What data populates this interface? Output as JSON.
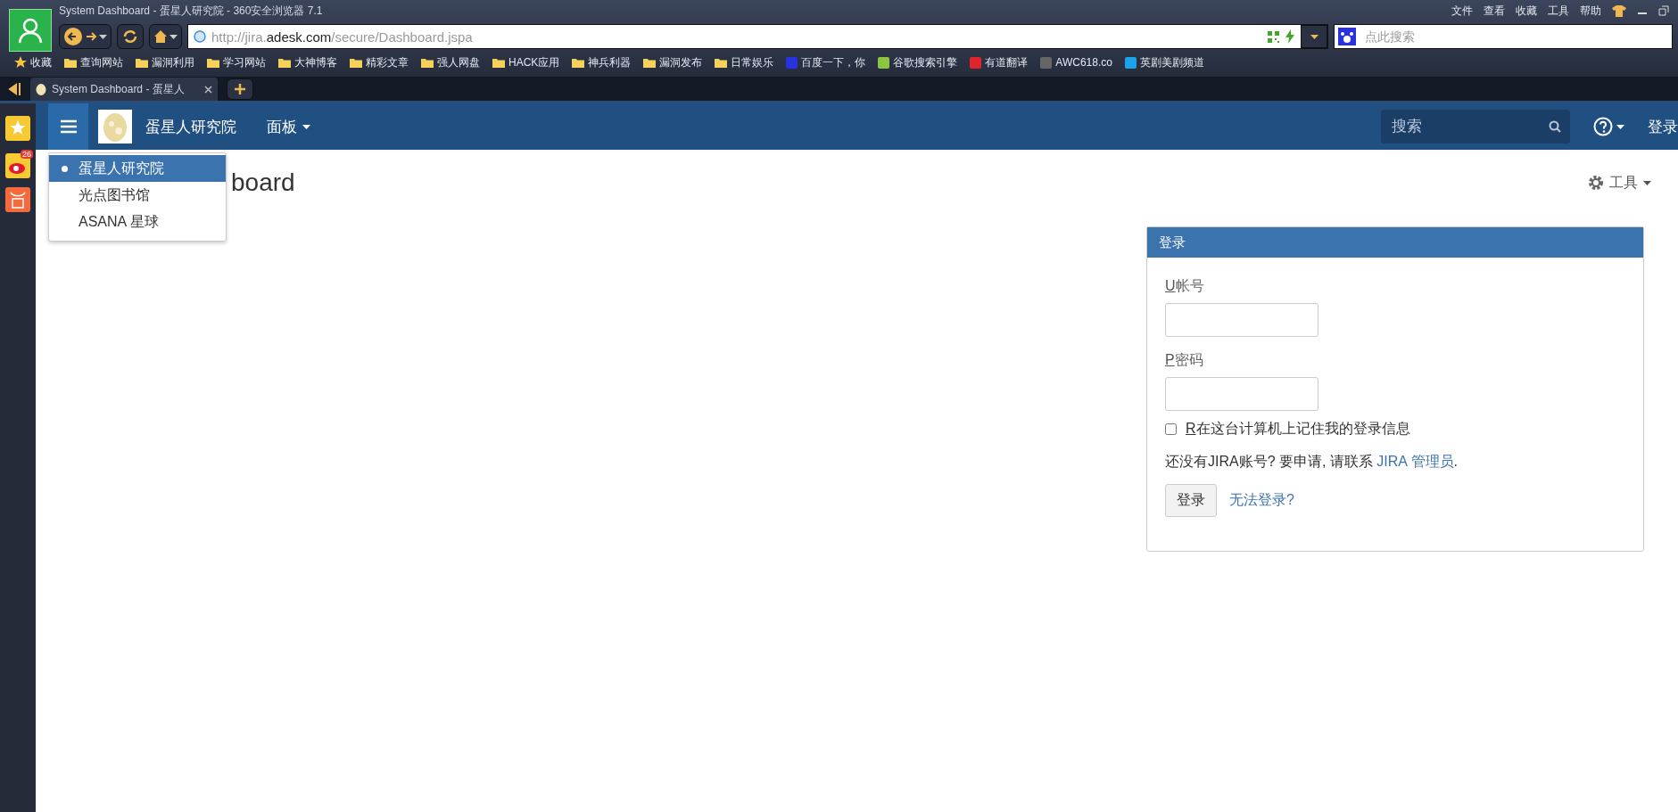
{
  "browser": {
    "title": "System Dashboard - 蛋星人研究院 - 360安全浏览器 7.1",
    "menu": [
      "文件",
      "查看",
      "收藏",
      "工具",
      "帮助"
    ],
    "url": {
      "scheme": "http://jira.",
      "domain": "adesk.com",
      "path": "/secure/Dashboard.jspa"
    },
    "search": {
      "placeholder": "点此搜索"
    },
    "bookmarks": [
      {
        "kind": "favorites",
        "label": "收藏"
      },
      {
        "kind": "folder",
        "label": "查询网站"
      },
      {
        "kind": "folder",
        "label": "漏洞利用"
      },
      {
        "kind": "folder",
        "label": "学习网站"
      },
      {
        "kind": "folder",
        "label": "大神博客"
      },
      {
        "kind": "folder",
        "label": "精彩文章"
      },
      {
        "kind": "folder",
        "label": "强人网盘"
      },
      {
        "kind": "folder",
        "label": "HACK应用"
      },
      {
        "kind": "folder",
        "label": "神兵利器"
      },
      {
        "kind": "folder",
        "label": "漏洞发布"
      },
      {
        "kind": "folder",
        "label": "日常娱乐"
      },
      {
        "kind": "site",
        "label": "百度一下，你",
        "color": "#2932e1"
      },
      {
        "kind": "site",
        "label": "谷歌搜索引擎",
        "color": "#8cc63f"
      },
      {
        "kind": "site",
        "label": "有道翻译",
        "color": "#e0242b"
      },
      {
        "kind": "site",
        "label": "AWC618.co",
        "color": "#666666"
      },
      {
        "kind": "site",
        "label": "英剧美剧频道",
        "color": "#1aa3e8"
      }
    ],
    "tabs": [
      {
        "title": "System Dashboard - 蛋星人",
        "selected": true
      }
    ],
    "sidebar": {
      "badge": "26"
    }
  },
  "app": {
    "brand": "蛋星人研究院",
    "menu": "面板",
    "search": {
      "placeholder": "搜索"
    },
    "login_link": "登录",
    "switcher": [
      {
        "label": "蛋星人研究院",
        "selected": true
      },
      {
        "label": "光点图书馆",
        "selected": false
      },
      {
        "label": "ASANA 星球",
        "selected": false
      }
    ],
    "page_title": "board",
    "tools": "工具",
    "login_panel": {
      "title": "登录",
      "username": {
        "accesskey": "U",
        "label": "帐号"
      },
      "password": {
        "accesskey": "P",
        "label": "密码"
      },
      "remember": {
        "accesskey": "R",
        "label": "在这台计算机上记住我的登录信息",
        "checked": false
      },
      "signup": {
        "text": "还没有JIRA账号? 要申请, 请联系 ",
        "link": "JIRA 管理员",
        "end": "."
      },
      "button": "登录",
      "help_link": "无法登录?"
    }
  }
}
